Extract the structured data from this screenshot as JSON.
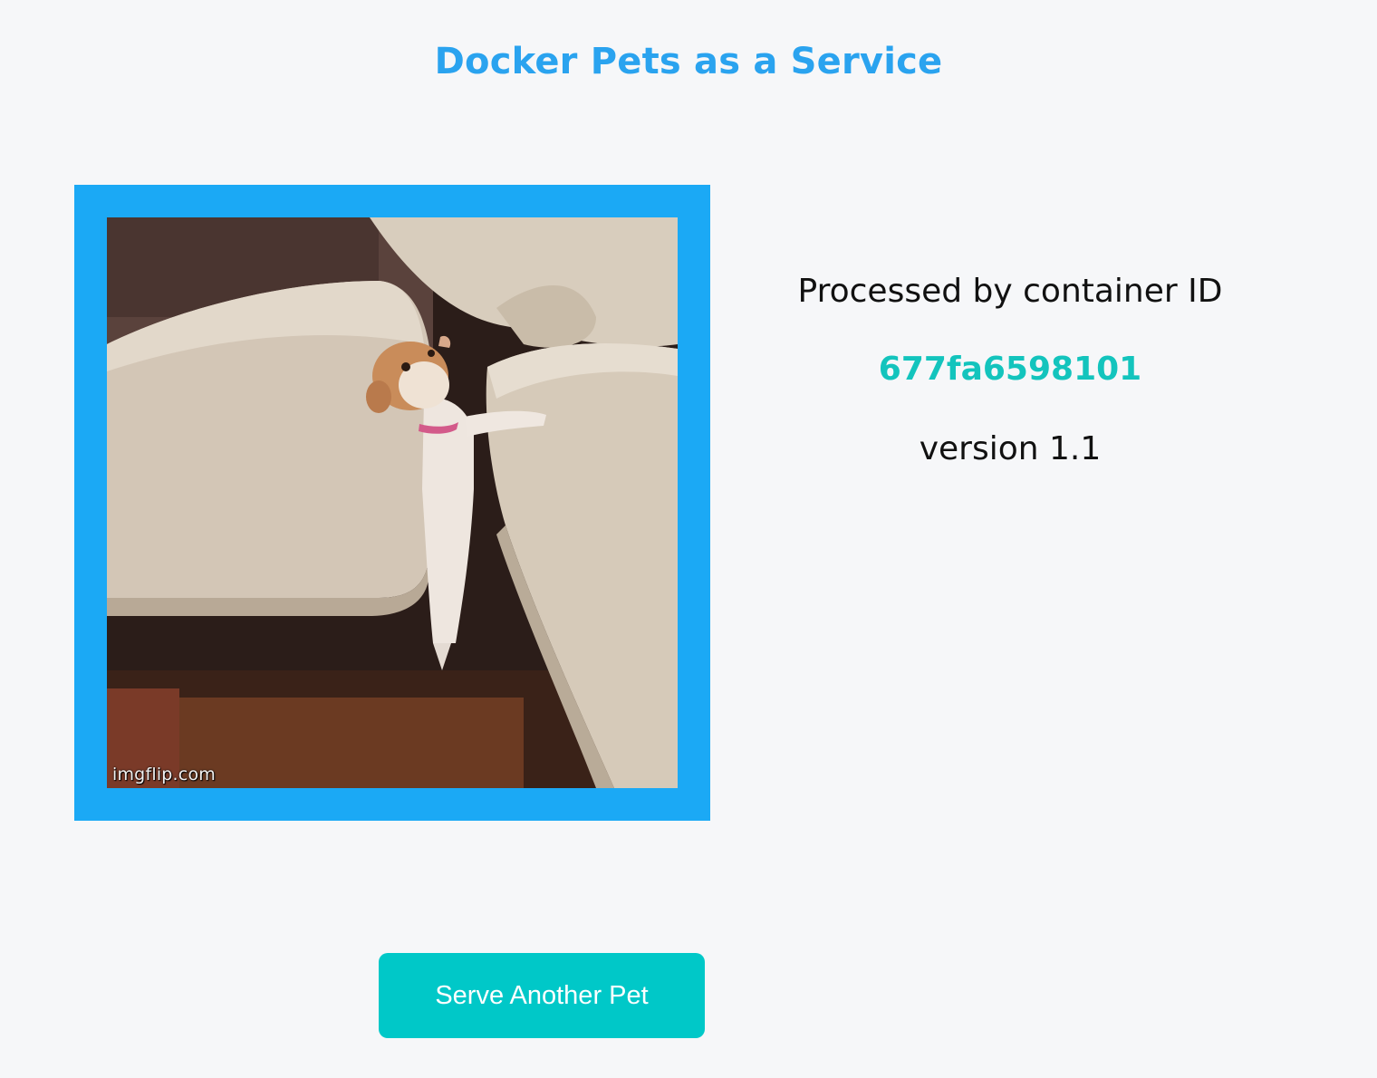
{
  "header": {
    "title": "Docker Pets as a Service"
  },
  "pet_card": {
    "image_subject": "small dog wedged between couch cushions",
    "watermark": "imgflip.com"
  },
  "info": {
    "processed_label": "Processed by container ID",
    "container_id": "677fa6598101",
    "version_label": "version 1.1"
  },
  "actions": {
    "serve_button_label": "Serve Another Pet"
  },
  "colors": {
    "title": "#2aa3ef",
    "frame": "#1ba9f5",
    "container_id": "#13c4bd",
    "button": "#00c8c8",
    "background": "#f6f7f9"
  }
}
